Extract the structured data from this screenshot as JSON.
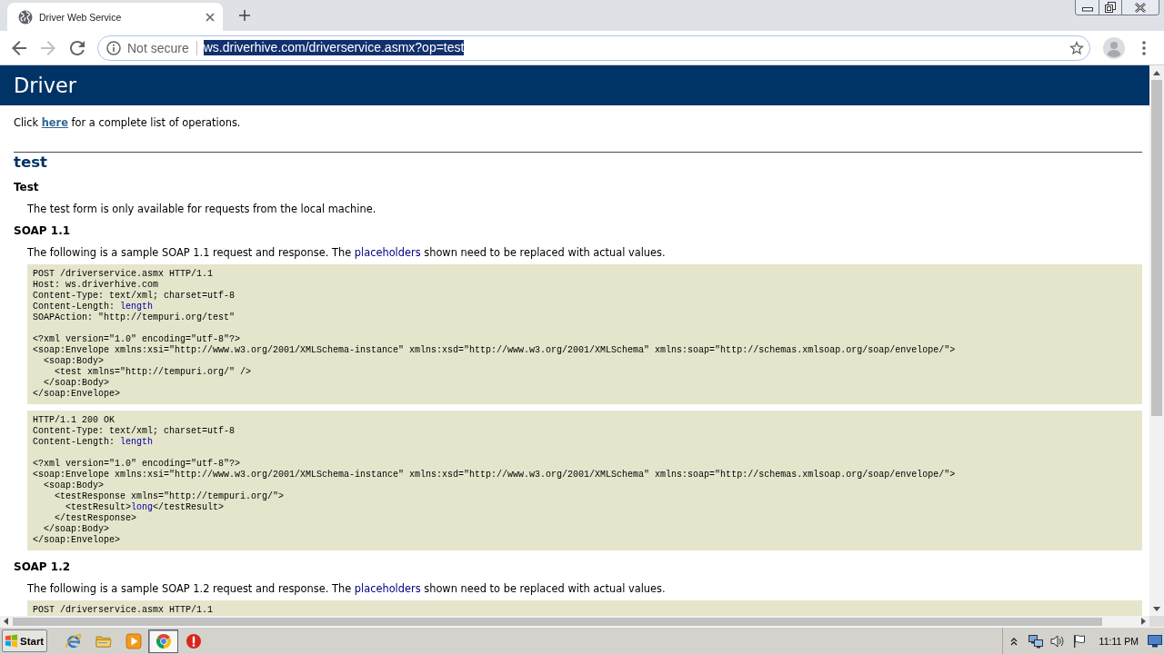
{
  "browser": {
    "tabs": [
      {
        "title": "Driver Web Service",
        "selected": true
      }
    ],
    "back": {
      "disabled": false
    },
    "forward": {
      "disabled": true
    },
    "address_bar": {
      "security": "Not secure",
      "url": "ws.driverhive.com/driverservice.asmx?op=test",
      "url_selected": true
    }
  },
  "page": {
    "banner": "Driver",
    "intro": [
      {
        "kind": "text",
        "text": "Click "
      },
      {
        "kind": "link",
        "text": "here"
      },
      {
        "kind": "text",
        "text": " for a complete list of operations."
      }
    ],
    "operation": "test",
    "sections": [
      {
        "heading": "Test",
        "text": [
          {
            "kind": "text",
            "text": "The test form is only available for requests from the local machine."
          }
        ]
      },
      {
        "heading": "SOAP 1.1",
        "text": [
          {
            "kind": "text",
            "text": "The following is a sample SOAP 1.1 request and response. The "
          },
          {
            "kind": "placeholder",
            "text": "placeholders"
          },
          {
            "kind": "text",
            "text": " shown need to be replaced with actual values."
          }
        ],
        "code_samples": [
          {
            "headers": [
              [
                {
                  "kind": "text",
                  "text": "POST /driverservice.asmx HTTP/1.1"
                }
              ],
              [
                {
                  "kind": "text",
                  "text": "Host: ws.driverhive.com"
                }
              ],
              [
                {
                  "kind": "text",
                  "text": "Content-Type: text/xml; charset=utf-8"
                }
              ],
              [
                {
                  "kind": "text",
                  "text": "Content-Length: "
                },
                {
                  "kind": "placeholder",
                  "text": "length"
                }
              ],
              [
                {
                  "kind": "text",
                  "text": "SOAPAction: \"http://tempuri.org/test\""
                }
              ]
            ],
            "body": [
              {
                "line": [
                  {
                    "kind": "text",
                    "text": "<?xml version=\"1.0\" encoding=\"utf-8\"?>"
                  }
                ]
              },
              {
                "line": [
                  {
                    "kind": "text",
                    "text": "<soap:Envelope xmlns:xsi=\"http://www.w3.org/2001/XMLSchema-instance\" xmlns:xsd=\"http://www.w3.org/2001/XMLSchema\" xmlns:soap=\"http://schemas.xmlsoap.org/soap/envelope/\">"
                  }
                ],
                "children": [
                  {
                    "line": [
                      {
                        "kind": "text",
                        "text": "<soap:Body>"
                      }
                    ],
                    "children": [
                      {
                        "line": [
                          {
                            "kind": "text",
                            "text": "<test xmlns=\"http://tempuri.org/\" />"
                          }
                        ]
                      }
                    ],
                    "close": [
                      {
                        "kind": "text",
                        "text": "</soap:Body>"
                      }
                    ]
                  }
                ],
                "close": [
                  {
                    "kind": "text",
                    "text": "</soap:Envelope>"
                  }
                ]
              }
            ]
          },
          {
            "headers": [
              [
                {
                  "kind": "text",
                  "text": "HTTP/1.1 200 OK"
                }
              ],
              [
                {
                  "kind": "text",
                  "text": "Content-Type: text/xml; charset=utf-8"
                }
              ],
              [
                {
                  "kind": "text",
                  "text": "Content-Length: "
                },
                {
                  "kind": "placeholder",
                  "text": "length"
                }
              ]
            ],
            "body": [
              {
                "line": [
                  {
                    "kind": "text",
                    "text": "<?xml version=\"1.0\" encoding=\"utf-8\"?>"
                  }
                ]
              },
              {
                "line": [
                  {
                    "kind": "text",
                    "text": "<soap:Envelope xmlns:xsi=\"http://www.w3.org/2001/XMLSchema-instance\" xmlns:xsd=\"http://www.w3.org/2001/XMLSchema\" xmlns:soap=\"http://schemas.xmlsoap.org/soap/envelope/\">"
                  }
                ],
                "children": [
                  {
                    "line": [
                      {
                        "kind": "text",
                        "text": "<soap:Body>"
                      }
                    ],
                    "children": [
                      {
                        "line": [
                          {
                            "kind": "text",
                            "text": "<testResponse xmlns=\"http://tempuri.org/\">"
                          }
                        ],
                        "children": [
                          {
                            "line": [
                              {
                                "kind": "text",
                                "text": "<testResult>"
                              },
                              {
                                "kind": "placeholder",
                                "text": "long"
                              },
                              {
                                "kind": "text",
                                "text": "</testResult>"
                              }
                            ]
                          }
                        ],
                        "close": [
                          {
                            "kind": "text",
                            "text": "</testResponse>"
                          }
                        ]
                      }
                    ],
                    "close": [
                      {
                        "kind": "text",
                        "text": "</soap:Body>"
                      }
                    ]
                  }
                ],
                "close": [
                  {
                    "kind": "text",
                    "text": "</soap:Envelope>"
                  }
                ]
              }
            ]
          }
        ]
      },
      {
        "heading": "SOAP 1.2",
        "text": [
          {
            "kind": "text",
            "text": "The following is a sample SOAP 1.2 request and response. The "
          },
          {
            "kind": "placeholder",
            "text": "placeholders"
          },
          {
            "kind": "text",
            "text": " shown need to be replaced with actual values."
          }
        ],
        "code_samples": [
          {
            "headers": [
              [
                {
                  "kind": "text",
                  "text": "POST /driverservice.asmx HTTP/1.1"
                }
              ]
            ]
          }
        ]
      }
    ]
  },
  "taskbar": {
    "start": "Start",
    "apps": [
      {
        "kind": "ie",
        "selected": false
      },
      {
        "kind": "folder",
        "selected": false
      },
      {
        "kind": "media",
        "selected": false
      },
      {
        "kind": "chrome",
        "selected": true
      },
      {
        "kind": "alert",
        "selected": false
      }
    ],
    "clock": "11:11 PM"
  }
}
